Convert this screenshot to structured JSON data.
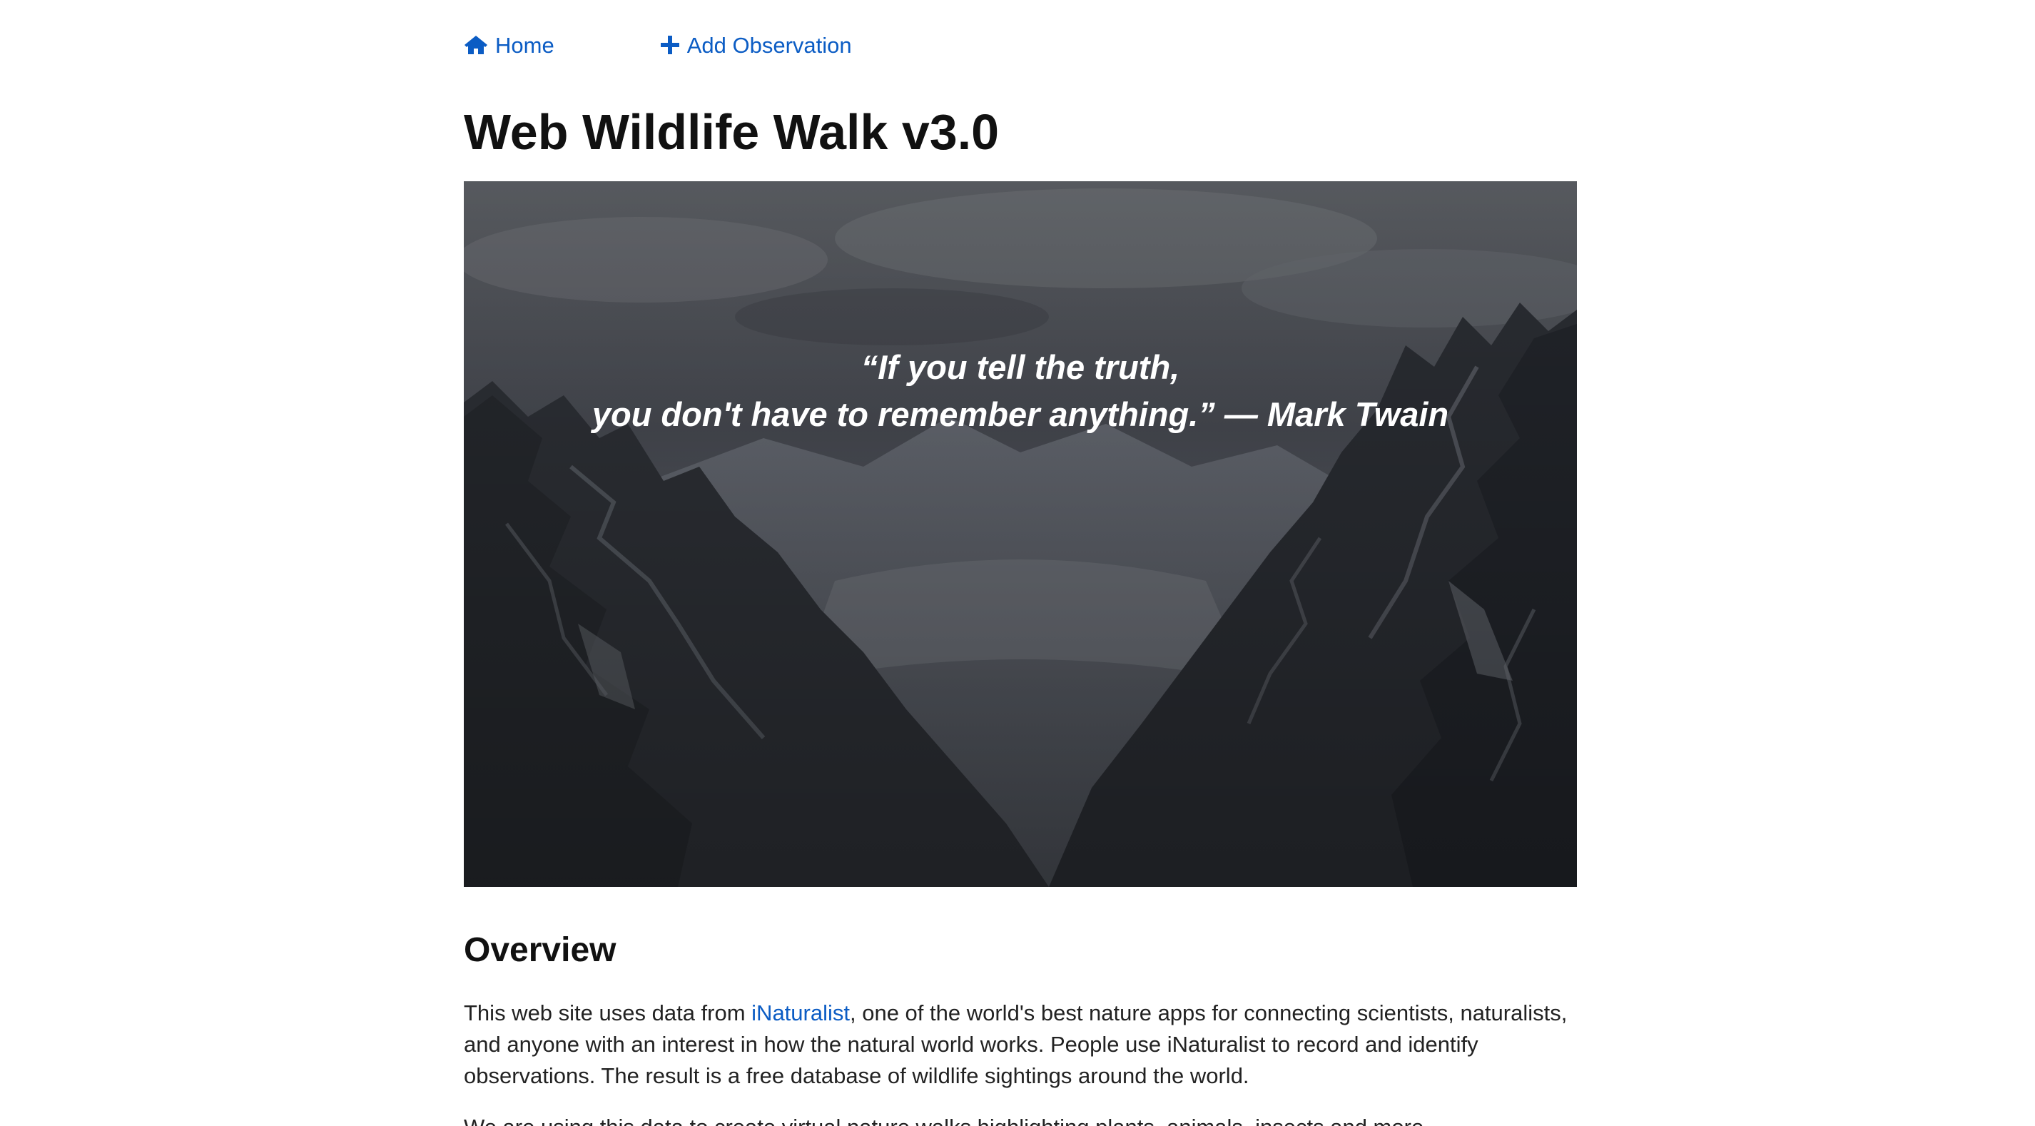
{
  "nav": {
    "home_label": "Home",
    "home_icon": "home-icon",
    "add_label": "Add Observation",
    "add_icon": "plus-icon",
    "link_color": "#0b5cc4"
  },
  "page_title": "Web Wildlife Walk v3.0",
  "hero": {
    "quote_line1": "“If you tell the truth,",
    "quote_line2": "you don't have to remember anything.” — Mark Twain"
  },
  "overview": {
    "heading": "Overview",
    "para1_before": "This web site uses data from ",
    "para1_link": "iNaturalist",
    "para1_after": ", one of the world's best nature apps for connecting scientists, naturalists, and anyone with an interest in how the natural world works. People use iNaturalist to record and identify observations. The result is a free database of wildlife sightings around the world.",
    "para2": "We are using this data to create virtual nature walks highlighting plants, animals, insects and more."
  }
}
